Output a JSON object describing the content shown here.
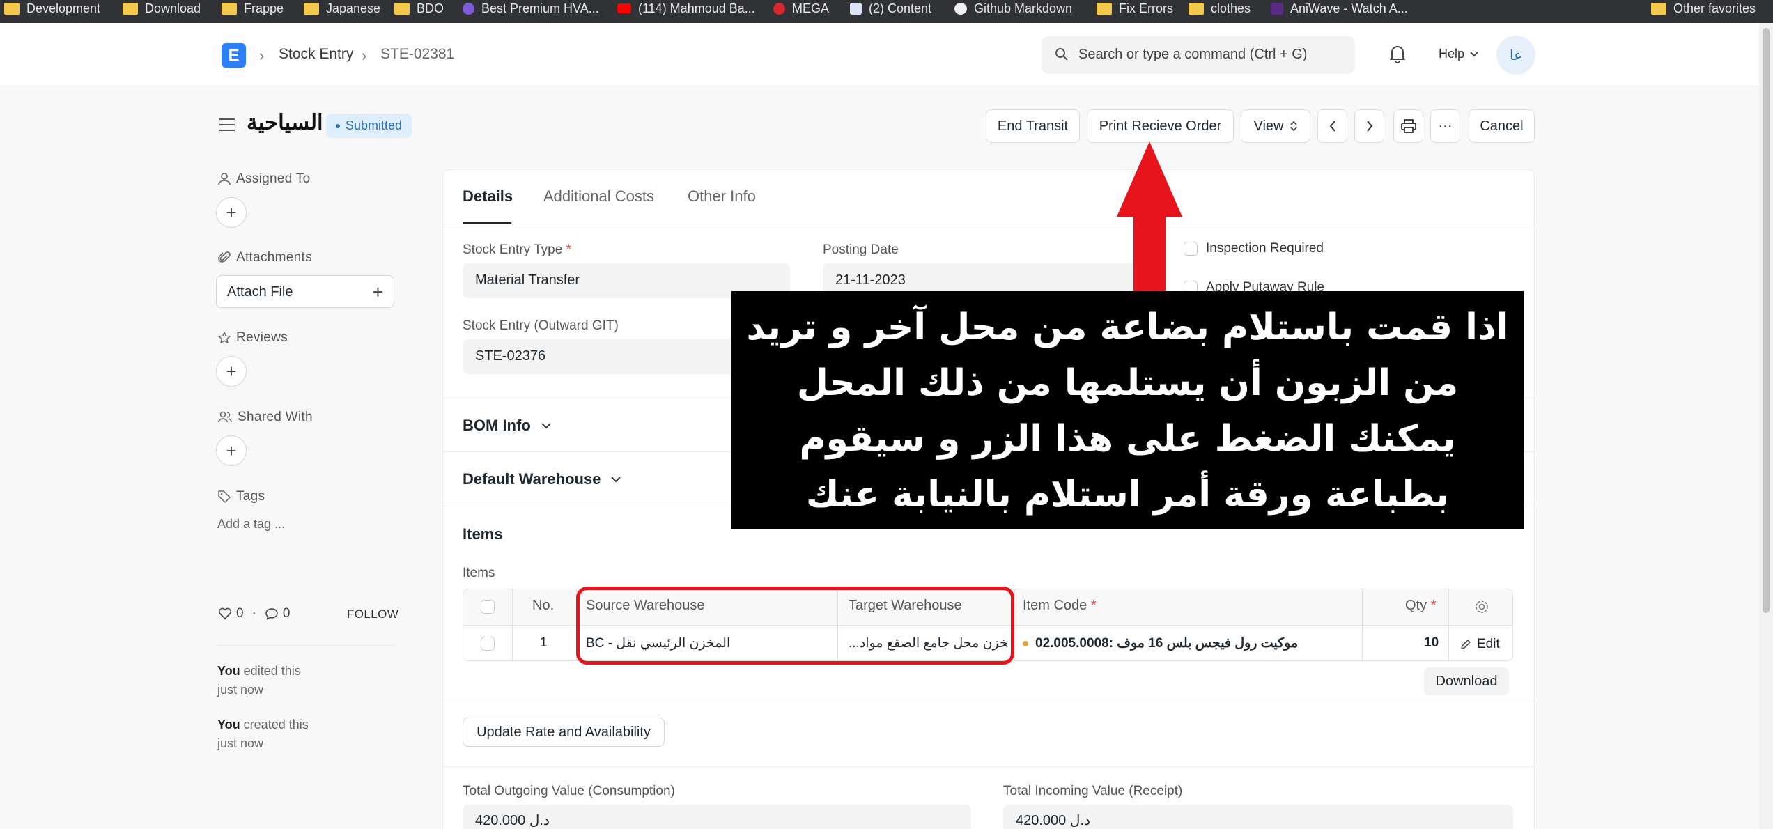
{
  "bookmarks": [
    {
      "label": "Development",
      "icon": "folder-icon"
    },
    {
      "label": "Download",
      "icon": "folder-icon"
    },
    {
      "label": "Frappe",
      "icon": "folder-icon"
    },
    {
      "label": "Japanese",
      "icon": "folder-icon"
    },
    {
      "label": "BDO",
      "icon": "folder-icon"
    },
    {
      "label": "Best Premium HVA...",
      "icon": "site-icon"
    },
    {
      "label": "(114) Mahmoud Ba...",
      "icon": "youtube-icon"
    },
    {
      "label": "MEGA",
      "icon": "mega-icon"
    },
    {
      "label": "(2) Content",
      "icon": "site-icon"
    },
    {
      "label": "Github Markdown",
      "icon": "github-icon"
    },
    {
      "label": "Fix Errors",
      "icon": "folder-icon"
    },
    {
      "label": "clothes",
      "icon": "folder-icon"
    },
    {
      "label": "AniWave - Watch A...",
      "icon": "site-icon"
    },
    {
      "label": "Other favorites",
      "icon": "folder-icon"
    }
  ],
  "header": {
    "logo": "E",
    "breadcrumb": [
      "Stock Entry",
      "STE-02381"
    ],
    "search_placeholder": "Search or type a command (Ctrl + G)",
    "help_label": "Help",
    "avatar_initials": "عا"
  },
  "doc": {
    "title": "السياحية",
    "status": "Submitted"
  },
  "toolbar": {
    "end_transit": "End Transit",
    "print_receive_order": "Print Recieve Order",
    "view": "View",
    "more": "···",
    "cancel": "Cancel"
  },
  "sidebar": {
    "assigned_to": "Assigned To",
    "attachments": "Attachments",
    "attach_file": "Attach File",
    "reviews": "Reviews",
    "shared_with": "Shared With",
    "tags": "Tags",
    "add_tag": "Add a tag ...",
    "likes": "0",
    "comments": "0",
    "follow": "FOLLOW",
    "activity": [
      {
        "who": "You",
        "what": " edited this",
        "when": "just now"
      },
      {
        "who": "You",
        "what": " created this",
        "when": "just now"
      }
    ]
  },
  "tabs": [
    "Details",
    "Additional Costs",
    "Other Info"
  ],
  "form": {
    "stock_entry_type_label": "Stock Entry Type",
    "stock_entry_type": "Material Transfer",
    "posting_date_label": "Posting Date",
    "posting_date": "21-11-2023",
    "inspection_required": "Inspection Required",
    "apply_putaway_rule": "Apply Putaway Rule",
    "outward_git_label": "Stock Entry (Outward GIT)",
    "outward_git": "STE-02376",
    "required_mark": "*"
  },
  "sections": {
    "bom_info": "BOM Info",
    "default_warehouse": "Default Warehouse",
    "items": "Items",
    "items_sub": "Items"
  },
  "items_table": {
    "columns": [
      "No.",
      "Source Warehouse",
      "Target Warehouse",
      "Item Code",
      "Qty"
    ],
    "rows": [
      {
        "no": "1",
        "source_warehouse": "المخزن الرئيسي نقل - BC",
        "target_warehouse": "مخزن محل جامع الصقع مواد...",
        "item_code": "02.005.0008: موكيت رول فيجس بلس 16 موف",
        "qty": "10",
        "edit": "Edit"
      }
    ],
    "download": "Download",
    "update_rate": "Update Rate and Availability"
  },
  "totals": {
    "outgoing_label": "Total Outgoing Value (Consumption)",
    "outgoing_value": "420.000 د.ل",
    "incoming_label": "Total Incoming Value (Receipt)",
    "incoming_value": "420.000 د.ل"
  },
  "annotation": {
    "text": "اذا قمت باستلام بضاعة من محل آخر و تريد من الزبون أن يستلمها من ذلك المحل يمكنك الضغط على هذا الزر و سيقوم بطباعة ورقة أمر استلام بالنيابة عنك",
    "arrow_color": "#e8141b",
    "box_color": "#e8141b"
  },
  "colors": {
    "accent": "#2d7ff9",
    "status_bg": "#deeefc",
    "status_text": "#2c6db3"
  }
}
